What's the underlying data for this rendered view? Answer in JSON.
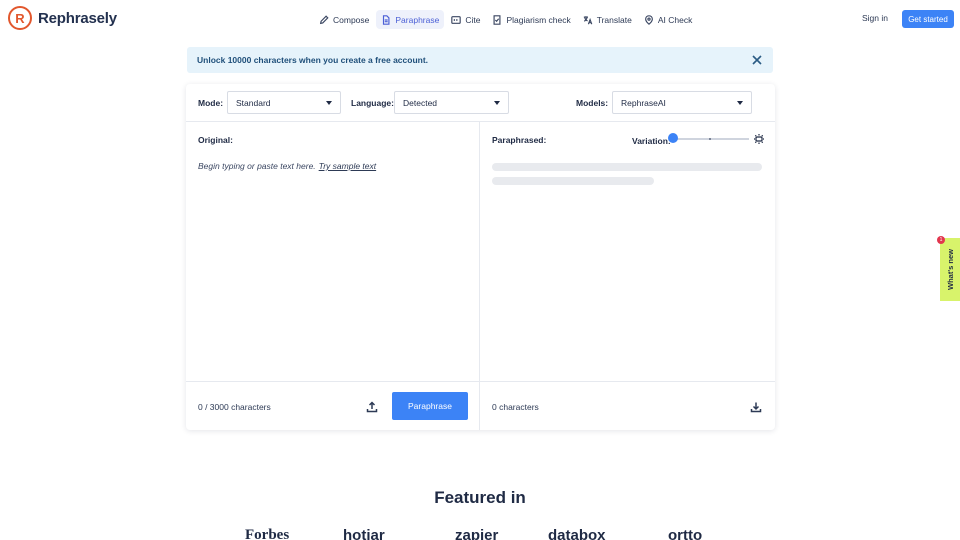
{
  "header": {
    "brand": "Rephrasely",
    "brand_mark": "R",
    "nav": [
      {
        "label": "Compose",
        "icon": "pen-icon"
      },
      {
        "label": "Paraphrase",
        "icon": "document-icon",
        "active": true
      },
      {
        "label": "Cite",
        "icon": "quote-icon"
      },
      {
        "label": "Plagiarism check",
        "icon": "file-check-icon"
      },
      {
        "label": "Translate",
        "icon": "translate-icon"
      },
      {
        "label": "AI Check",
        "icon": "shield-icon"
      }
    ],
    "signin": "Sign in",
    "get_started": "Get started"
  },
  "banner": {
    "text": "Unlock 10000 characters when you create a free account."
  },
  "toolbar": {
    "mode_label": "Mode:",
    "mode_value": "Standard",
    "language_label": "Language:",
    "language_value": "Detected",
    "models_label": "Models:",
    "models_value": "RephraseAI"
  },
  "original": {
    "title": "Original:",
    "placeholder": "Begin typing or paste text here.",
    "sample_link": "Try sample text",
    "char_count": "0 / 3000 characters",
    "paraphrase_button": "Paraphrase"
  },
  "paraphrased": {
    "title": "Paraphrased:",
    "variation_label": "Variation:",
    "variation_level": 0,
    "char_count": "0 characters"
  },
  "whats_new": {
    "label": "What's new",
    "badge": "1"
  },
  "featured": {
    "title": "Featured in",
    "logos": [
      "Forbes",
      "hotjar",
      "zapier",
      "databox",
      "ortto"
    ]
  },
  "colors": {
    "accent": "#3c83f6",
    "brand": "#e2572d",
    "banner_bg": "#e6f3fb",
    "whats_new_bg": "#d8f36b"
  }
}
